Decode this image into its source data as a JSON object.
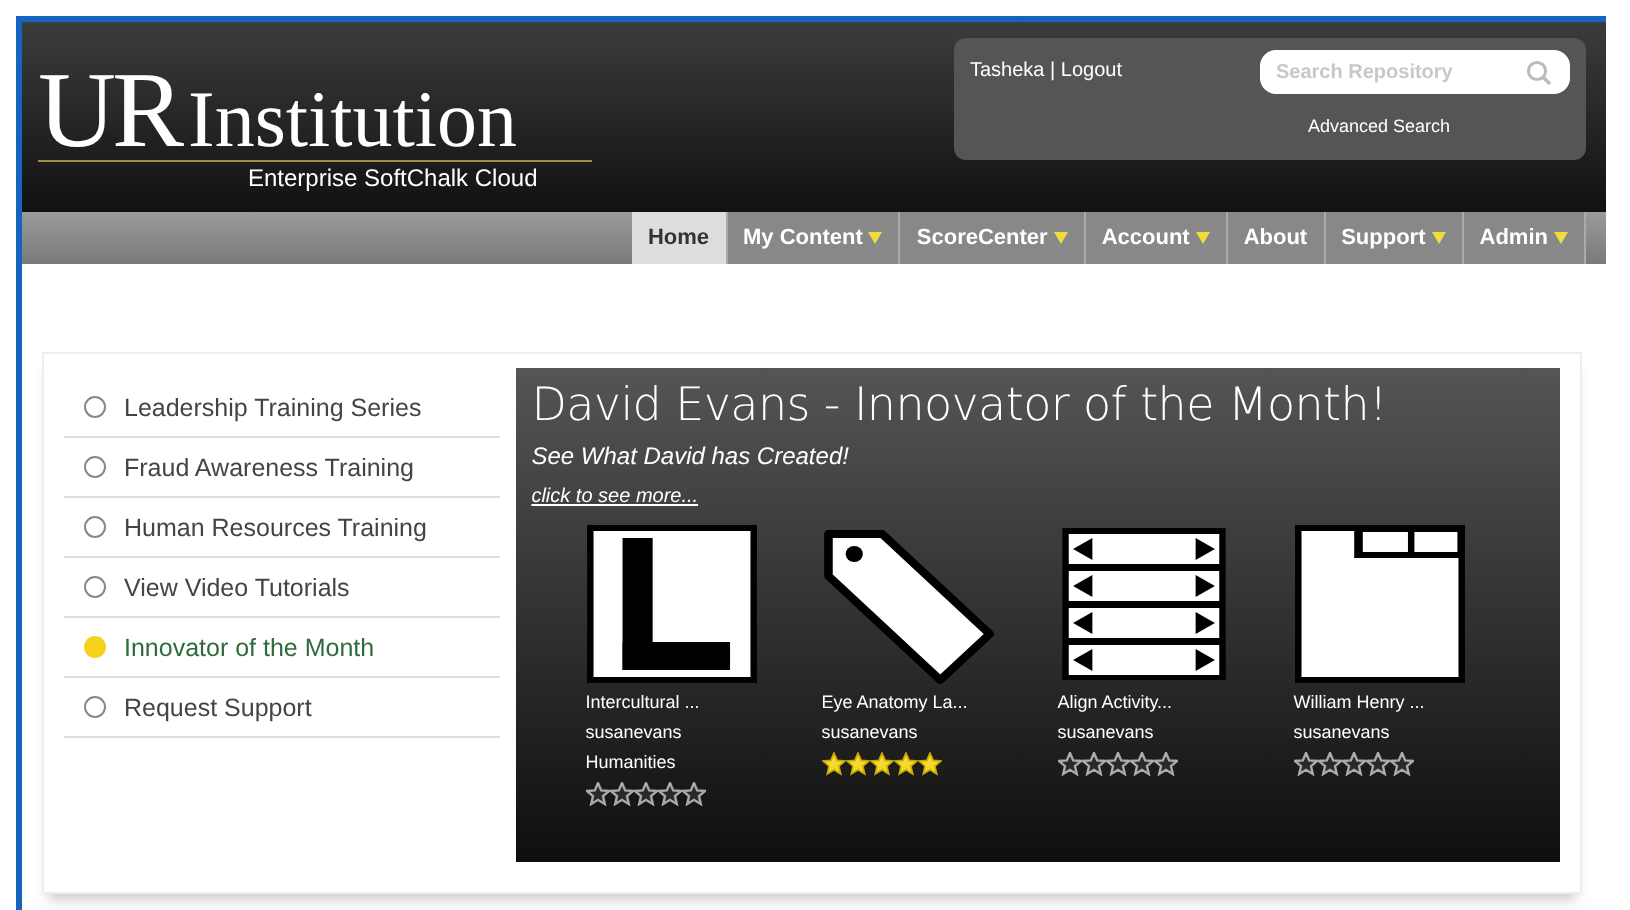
{
  "header": {
    "logo_main": "UR",
    "logo_sub": "Institution",
    "tagline": "Enterprise SoftChalk Cloud",
    "user": "Tasheka | Logout",
    "search": {
      "placeholder": "Search Repository"
    },
    "advanced_search": "Advanced Search"
  },
  "nav": [
    {
      "label": "Home",
      "selected": true,
      "dropdown": false
    },
    {
      "label": "My Content",
      "selected": false,
      "dropdown": true
    },
    {
      "label": "ScoreCenter",
      "selected": false,
      "dropdown": true
    },
    {
      "label": "Account",
      "selected": false,
      "dropdown": true
    },
    {
      "label": "About",
      "selected": false,
      "dropdown": false
    },
    {
      "label": "Support",
      "selected": false,
      "dropdown": true
    },
    {
      "label": "Admin",
      "selected": false,
      "dropdown": true
    }
  ],
  "sidebar": {
    "items": [
      {
        "label": "Leadership Training Series",
        "selected": false
      },
      {
        "label": "Fraud Awareness Training",
        "selected": false
      },
      {
        "label": "Human Resources Training",
        "selected": false
      },
      {
        "label": "View Video Tutorials",
        "selected": false
      },
      {
        "label": "Innovator of the Month",
        "selected": true
      },
      {
        "label": "Request Support",
        "selected": false
      }
    ]
  },
  "feature": {
    "title": "David Evans - Innovator of the Month!",
    "subtitle": "See What David has Created!",
    "link": "click to see more...",
    "items": [
      {
        "kind": "letter",
        "title": "Intercultural ...",
        "author": "susanevans",
        "category": "Humanities",
        "stars": 0
      },
      {
        "kind": "tag",
        "title": "Eye Anatomy La...",
        "author": "susanevans",
        "stars": 5
      },
      {
        "kind": "align",
        "title": "Align Activity...",
        "author": "susanevans",
        "stars": 0
      },
      {
        "kind": "tabs",
        "title": "William Henry ...",
        "author": "susanevans",
        "stars": 0
      }
    ]
  }
}
